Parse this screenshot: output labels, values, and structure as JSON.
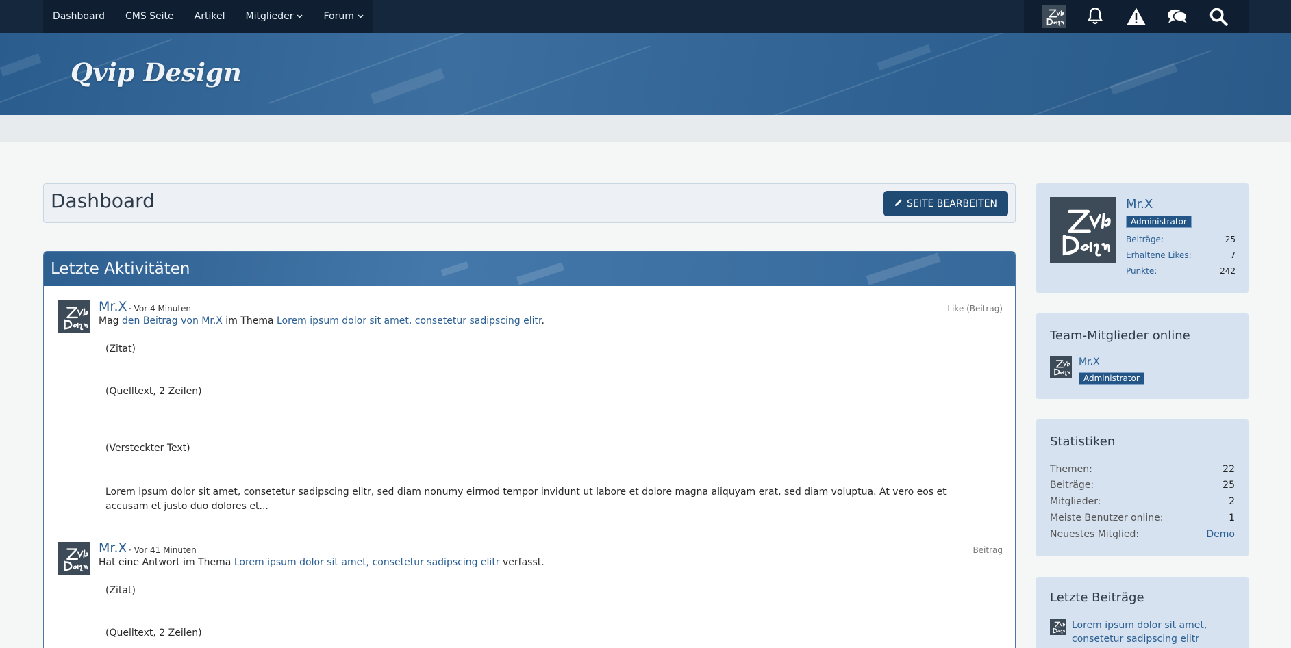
{
  "nav": {
    "items": [
      {
        "label": "Dashboard",
        "dropdown": false
      },
      {
        "label": "CMS Seite",
        "dropdown": false
      },
      {
        "label": "Artikel",
        "dropdown": false
      },
      {
        "label": "Mitglieder",
        "dropdown": true
      },
      {
        "label": "Forum",
        "dropdown": true
      }
    ],
    "icons": [
      "user-avatar",
      "bell-icon",
      "warning-icon",
      "chat-icon",
      "search-icon"
    ]
  },
  "banner": {
    "logo_text": "Qvip Design"
  },
  "page": {
    "title": "Dashboard",
    "edit_label": "SEITE BEARBEITEN"
  },
  "activity": {
    "title": "Letzte Aktivitäten",
    "entries": [
      {
        "user": "Mr.X",
        "time": "· Vor 4 Minuten",
        "kind": "Like (Beitrag)",
        "prefix": "Mag ",
        "link1": "den Beitrag von Mr.X",
        "middle": " im Thema ",
        "link2": "Lorem ipsum dolor sit amet, consetetur sadipscing elitr",
        "suffix": ".",
        "quote": "(Zitat)",
        "code": "(Quelltext, 2 Zeilen)",
        "hidden": "(Versteckter Text)",
        "lorem": "Lorem ipsum dolor sit amet, consetetur sadipscing elitr, sed diam nonumy eirmod tempor invidunt ut labore et dolore magna aliquyam erat, sed diam voluptua. At vero eos et accusam et justo duo dolores et..."
      },
      {
        "user": "Mr.X",
        "time": "· Vor 41 Minuten",
        "kind": "Beitrag",
        "prefix": "Hat eine Antwort im Thema ",
        "link2": "Lorem ipsum dolor sit amet, consetetur sadipscing elitr",
        "suffix": " verfasst.",
        "quote": "(Zitat)",
        "code": "(Quelltext, 2 Zeilen)"
      }
    ]
  },
  "sidebar": {
    "profile": {
      "name": "Mr.X",
      "role": "Administrator",
      "stats": [
        {
          "label": "Beiträge:",
          "value": "25"
        },
        {
          "label": "Erhaltene Likes:",
          "value": "7"
        },
        {
          "label": "Punkte:",
          "value": "242"
        }
      ]
    },
    "team": {
      "title": "Team-Mitglieder online",
      "name": "Mr.X",
      "role": "Administrator"
    },
    "stats": {
      "title": "Statistiken",
      "rows": [
        {
          "label": "Themen:",
          "value": "22"
        },
        {
          "label": "Beiträge:",
          "value": "25"
        },
        {
          "label": "Mitglieder:",
          "value": "2"
        },
        {
          "label": "Meiste Benutzer online:",
          "value": "1"
        },
        {
          "label": "Neuestes Mitglied:",
          "value": "Demo"
        }
      ]
    },
    "latest": {
      "title": "Letzte Beiträge",
      "item_line1": "Lorem ipsum dolor sit amet,",
      "item_line2": "consetetur sadipscing elitr"
    }
  },
  "colors": {
    "nav_bg": "#14273c",
    "accent": "#2b5f93",
    "button": "#1f4a74",
    "sidebar_bg": "#d6e2ef"
  }
}
